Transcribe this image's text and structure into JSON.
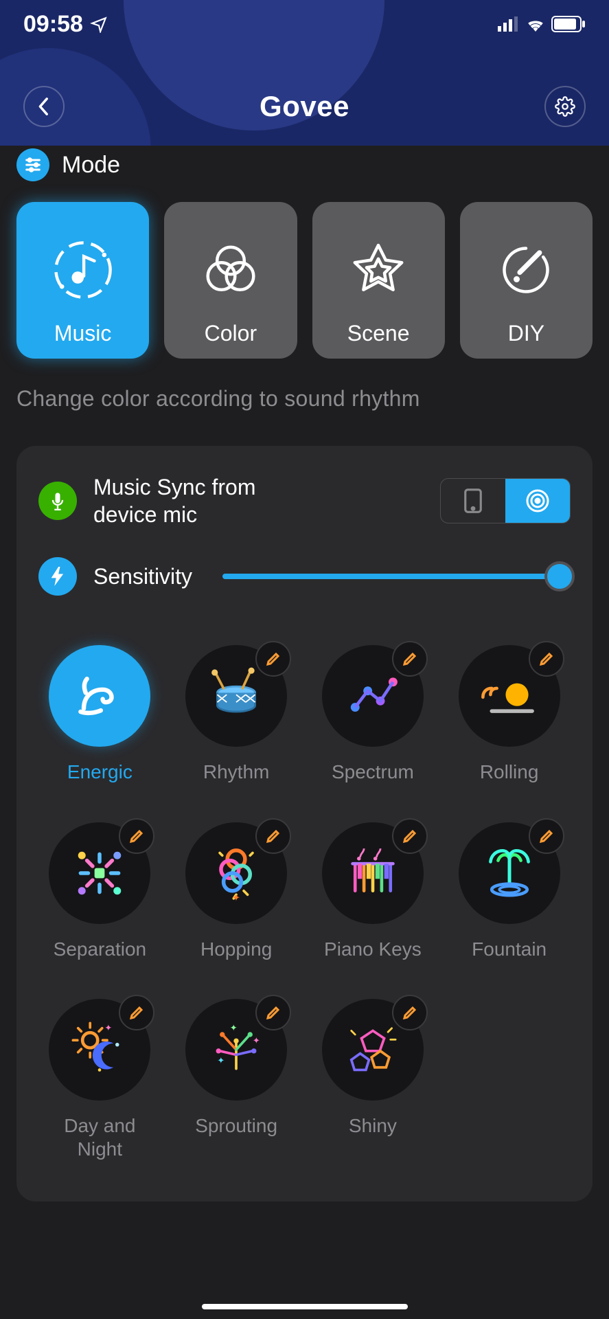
{
  "statusbar": {
    "time": "09:58"
  },
  "brand": "Govee",
  "section": {
    "title": "Mode"
  },
  "modes": {
    "tagline": "Change color according to sound rhythm",
    "items": [
      {
        "label": "Music",
        "active": true
      },
      {
        "label": "Color",
        "active": false
      },
      {
        "label": "Scene",
        "active": false
      },
      {
        "label": "DIY",
        "active": false
      }
    ]
  },
  "sync": {
    "line1": "Music Sync from",
    "line2": "device mic",
    "source": "device"
  },
  "sensitivity": {
    "label": "Sensitivity",
    "value": 100
  },
  "effects": [
    {
      "label": "Energic",
      "editable": false,
      "active": true,
      "icon": "flex-icon"
    },
    {
      "label": "Rhythm",
      "editable": true,
      "active": false,
      "icon": "drum-icon"
    },
    {
      "label": "Spectrum",
      "editable": true,
      "active": false,
      "icon": "spectrum-icon"
    },
    {
      "label": "Rolling",
      "editable": true,
      "active": false,
      "icon": "rolling-icon"
    },
    {
      "label": "Separation",
      "editable": true,
      "active": false,
      "icon": "separation-icon"
    },
    {
      "label": "Hopping",
      "editable": true,
      "active": false,
      "icon": "hopping-icon"
    },
    {
      "label": "Piano Keys",
      "editable": true,
      "active": false,
      "icon": "piano-icon"
    },
    {
      "label": "Fountain",
      "editable": true,
      "active": false,
      "icon": "fountain-icon"
    },
    {
      "label": "Day and Night",
      "editable": true,
      "active": false,
      "icon": "daynight-icon"
    },
    {
      "label": "Sprouting",
      "editable": true,
      "active": false,
      "icon": "sprouting-icon"
    },
    {
      "label": "Shiny",
      "editable": true,
      "active": false,
      "icon": "shiny-icon"
    }
  ]
}
